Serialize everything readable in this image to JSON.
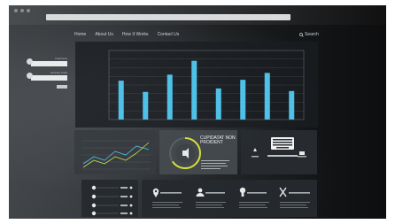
{
  "nav": {
    "items": [
      "Home",
      "About Us",
      "How It Works",
      "Contact Us"
    ],
    "search_label": "Search"
  },
  "login": {
    "username_label": "Username",
    "password_label": "Security Code"
  },
  "main_card": {
    "title": "CUPIDATAT NON PROIDENT"
  },
  "chart_data": {
    "type": "bar",
    "values": [
      45,
      32,
      52,
      68,
      36,
      46,
      54,
      33
    ]
  },
  "colors": {
    "bar": "#4fc1e9",
    "line_a": "#4fc1e9",
    "line_b": "#c2d94a",
    "gauge": "#d6df3b"
  },
  "feature_icons": [
    "location-pin-icon",
    "user-icon",
    "lightbulb-icon",
    "tools-icon"
  ]
}
